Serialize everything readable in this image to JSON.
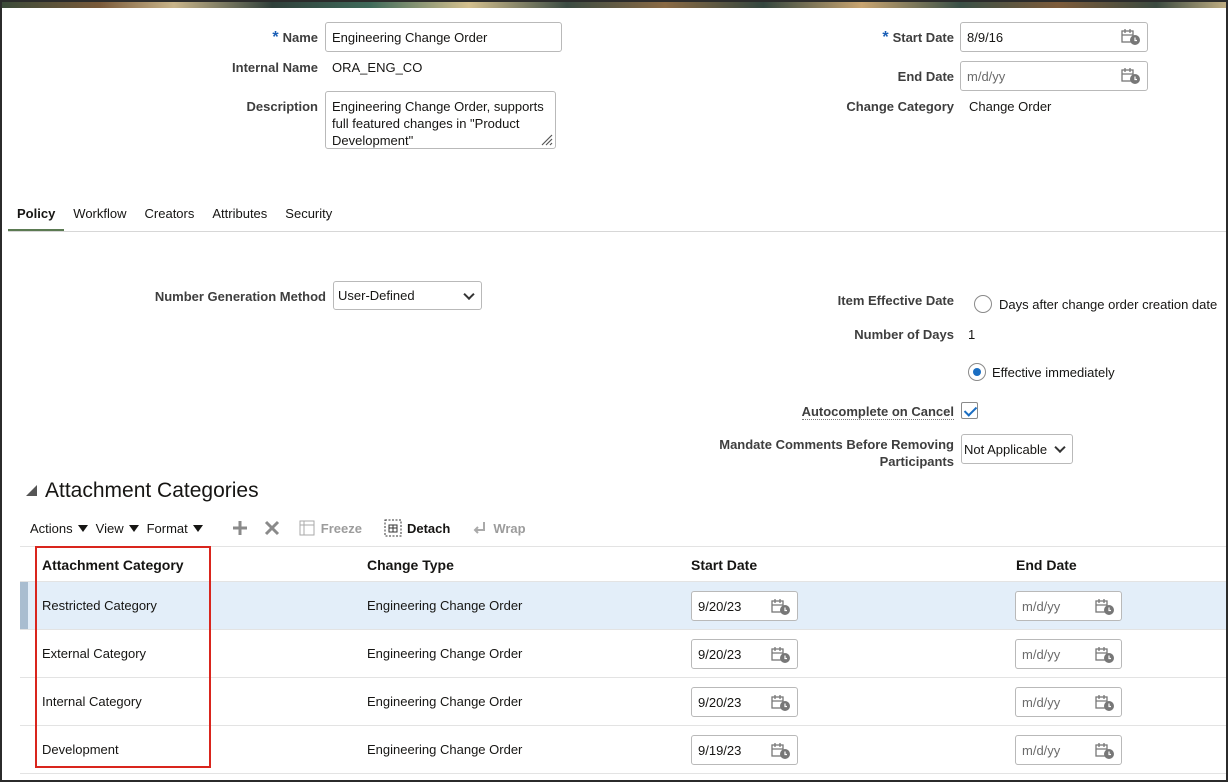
{
  "header": {
    "name_label": "Name",
    "name_value": "Engineering Change Order",
    "internal_name_label": "Internal Name",
    "internal_name_value": "ORA_ENG_CO",
    "description_label": "Description",
    "description_value": "Engineering Change Order, supports full featured changes in \"Product Development\"",
    "start_date_label": "Start Date",
    "start_date_value": "8/9/16",
    "end_date_label": "End Date",
    "end_date_placeholder": "m/d/yy",
    "change_category_label": "Change Category",
    "change_category_value": "Change Order",
    "required_marker": "*"
  },
  "tabs": [
    {
      "label": "Policy",
      "active": true
    },
    {
      "label": "Workflow"
    },
    {
      "label": "Creators"
    },
    {
      "label": "Attributes"
    },
    {
      "label": "Security"
    }
  ],
  "policy": {
    "number_generation_label": "Number Generation Method",
    "number_generation_value": "User-Defined",
    "item_effective_date_label": "Item Effective Date",
    "option_days_after": "Days after change order creation date",
    "number_of_days_label": "Number of Days",
    "number_of_days_value": "1",
    "option_effective_immediately": "Effective immediately",
    "selected_option": "Effective immediately",
    "autocomplete_label": "Autocomplete on Cancel",
    "autocomplete_checked": true,
    "mandate_label_line1": "Mandate Comments Before Removing",
    "mandate_label_line2": "Participants",
    "mandate_value": "Not Applicable"
  },
  "attachments": {
    "title": "Attachment Categories",
    "toolbar": {
      "actions": "Actions",
      "view": "View",
      "format": "Format",
      "freeze": "Freeze",
      "detach": "Detach",
      "wrap": "Wrap"
    },
    "columns": [
      "Attachment Category",
      "Change Type",
      "Start Date",
      "End Date"
    ],
    "end_date_placeholder": "m/d/yy",
    "rows": [
      {
        "category": "Restricted Category",
        "change_type": "Engineering Change Order",
        "start_date": "9/20/23",
        "selected": true
      },
      {
        "category": "External Category",
        "change_type": "Engineering Change Order",
        "start_date": "9/20/23"
      },
      {
        "category": "Internal Category",
        "change_type": "Engineering Change Order",
        "start_date": "9/20/23"
      },
      {
        "category": "Development",
        "change_type": "Engineering Change Order",
        "start_date": "9/19/23"
      }
    ]
  },
  "colors": {
    "accent_blue": "#1b6ec2",
    "tab_underline": "#5b7a52",
    "selected_row": "#e3eef9",
    "highlight_box": "#d9251d"
  }
}
